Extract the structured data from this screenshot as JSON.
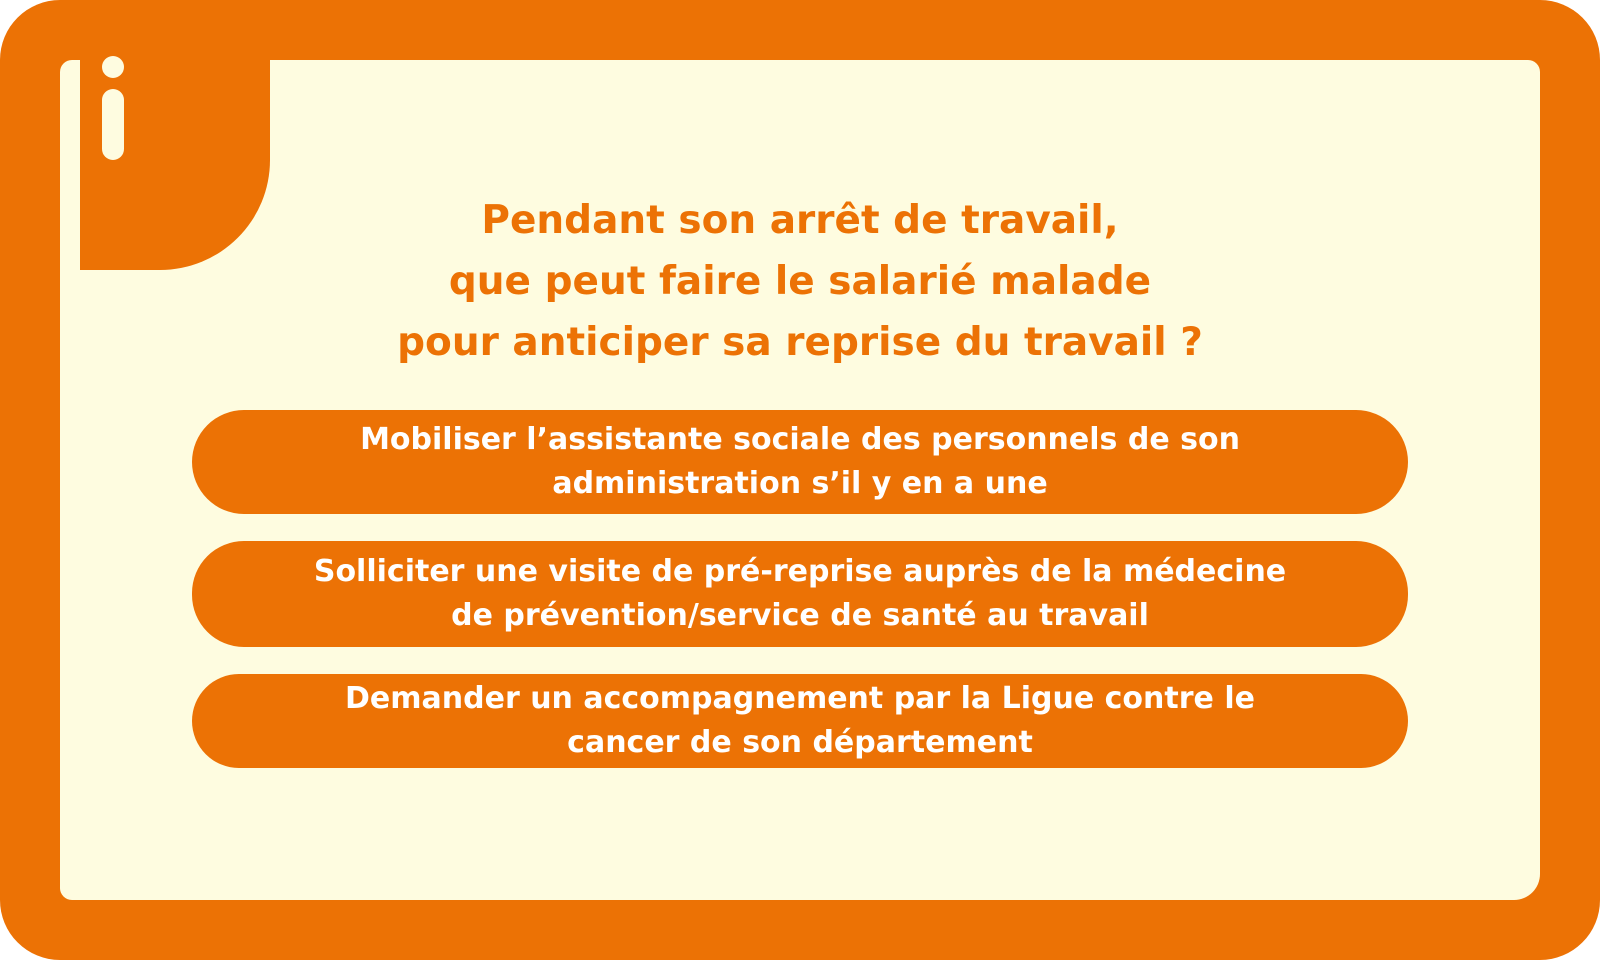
{
  "colors": {
    "accent": "#EC7205",
    "background": "#FEFCE0",
    "text_on_accent": "#FFFFFF"
  },
  "badge": {
    "icon": "info-icon"
  },
  "title": "Pendant son arrêt de travail,\nque peut faire le salarié malade\npour anticiper sa reprise du travail ?",
  "items": [
    {
      "label": "Mobiliser l’assistante sociale des personnels de son\nadministration s’il y en a une"
    },
    {
      "label": "Solliciter une visite de pré-reprise auprès de la médecine\nde prévention/service de santé au travail"
    },
    {
      "label": "Demander un accompagnement par la Ligue contre le\ncancer de son département"
    }
  ]
}
